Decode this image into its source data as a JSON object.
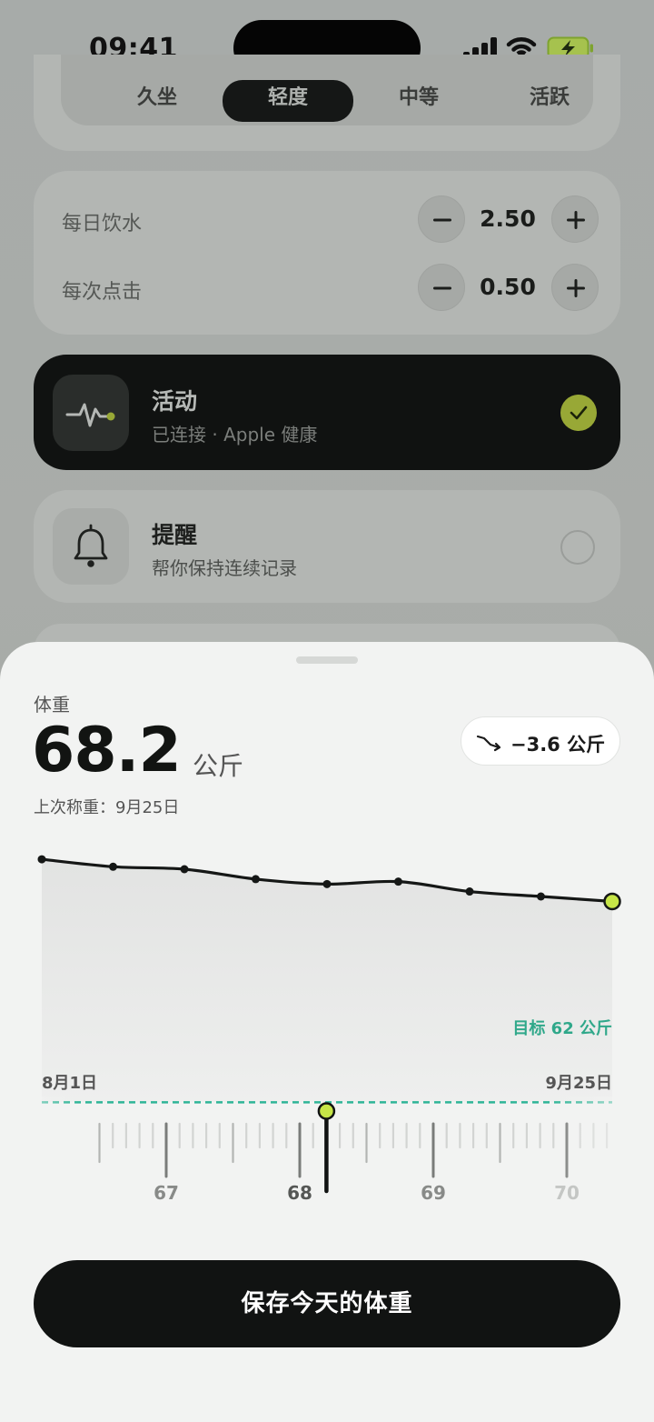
{
  "status_bar": {
    "time": "09:41"
  },
  "activity_level": {
    "options": [
      "久坐",
      "轻度",
      "中等",
      "活跃"
    ],
    "selected": "轻度"
  },
  "water": {
    "daily_label": "每日饮水",
    "daily_value": "2.50",
    "tap_label": "每次点击",
    "tap_value": "0.50"
  },
  "activity_card": {
    "title": "活动",
    "subtitle": "已连接 · Apple 健康",
    "connected": true
  },
  "reminder_card": {
    "title": "提醒",
    "subtitle": "帮你保持连续记录",
    "enabled": false
  },
  "weight_sheet": {
    "label": "体重",
    "value": "68.2",
    "unit": "公斤",
    "last_weighed": "上次称重：9月25日",
    "trend": "−3.6 公斤",
    "goal_label": "目标 62 公斤",
    "start_date": "8月1日",
    "end_date": "9月25日",
    "ruler_labels": [
      "67",
      "68",
      "69",
      "70"
    ],
    "save_button": "保存今天的体重"
  },
  "colors": {
    "accent_lime": "#c6e547",
    "goal_teal": "#2fb597",
    "dark": "#111312"
  },
  "chart_data": {
    "type": "area",
    "x": [
      "8月1日",
      "",
      "",
      "",
      "",
      "",
      "",
      "",
      "9月25日"
    ],
    "values": [
      71.8,
      71.5,
      71.4,
      71.0,
      70.8,
      70.9,
      70.5,
      70.3,
      70.1
    ],
    "goal": 62,
    "ylim": [
      61.5,
      72.5
    ]
  },
  "ruler_data": {
    "min": 66.5,
    "max": 70.5,
    "step": 0.1,
    "current": 68.2
  }
}
